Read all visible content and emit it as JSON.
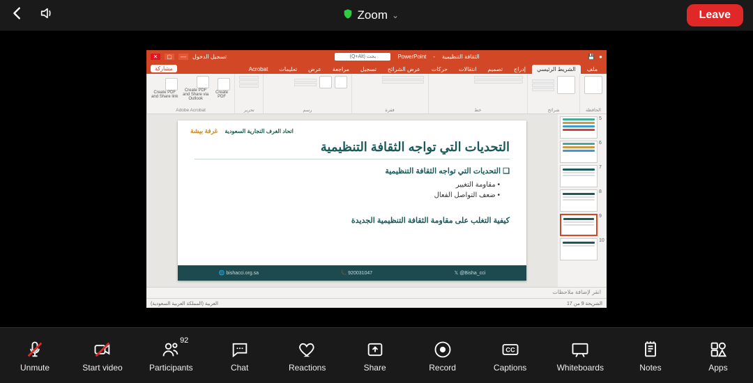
{
  "topbar": {
    "title": "Zoom",
    "leave_label": "Leave"
  },
  "controls": {
    "unmute": "Unmute",
    "start_video": "Start video",
    "participants": "Participants",
    "participants_count": "92",
    "chat": "Chat",
    "reactions": "Reactions",
    "share": "Share",
    "record": "Record",
    "captions": "Captions",
    "whiteboards": "Whiteboards",
    "notes": "Notes",
    "apps": "Apps"
  },
  "powerpoint": {
    "app_name": "PowerPoint",
    "doc_name": "الثقافة التنظيمية",
    "search_placeholder": "بحث (Q+Alt)",
    "account_hint": "تسجيل الدخول",
    "share_btn": "مشاركة",
    "tabs": {
      "file": "ملف",
      "home": "الشريط الرئيسي",
      "insert": "إدراج",
      "design": "تصميم",
      "transitions": "انتقالات",
      "animations": "حركات",
      "slideshow": "عرض الشرائح",
      "record": "تسجيل",
      "review": "مراجعة",
      "view": "عرض",
      "help": "تعليمات",
      "acrobat": "Acrobat"
    },
    "ribbon_groups": {
      "clipboard": "الحافظة",
      "slides": "شرائح",
      "font": "خط",
      "paragraph": "فقرة",
      "drawing": "رسم",
      "editing": "تحرير",
      "adobe": "Adobe Acrobat"
    },
    "ribbon_adobe": {
      "create_pdf": "Create PDF",
      "create_share": "Create PDF and Share via Outlook",
      "create_share_link": "Create PDF and Share link"
    },
    "slide": {
      "logo_a": "غرفة بيشة",
      "logo_b": "اتحاد الغرف التجارية السعودية",
      "title": "التحديات التي تواجه الثقافة التنظيمية",
      "subheading": "التحديات التي تواجه الثقافة التنظيمية",
      "bullet1": "مقاومة التغيير",
      "bullet2": "ضعف التواصل الفعال",
      "subheading2": "كيفية التغلب على مقاومة الثقافة التنظيمية الجديدة",
      "footer_site": "bishacci.org.sa",
      "footer_phone": "920031047",
      "footer_handle": "@Bisha_cci"
    },
    "thumbs": [
      "5",
      "6",
      "7",
      "8",
      "9",
      "10"
    ],
    "selected_thumb": "9",
    "notes_placeholder": "انقر لإضافة ملاحظات",
    "status_left": "الشريحة 9 من 17",
    "status_lang": "العربية (المملكة العربية السعودية)"
  }
}
